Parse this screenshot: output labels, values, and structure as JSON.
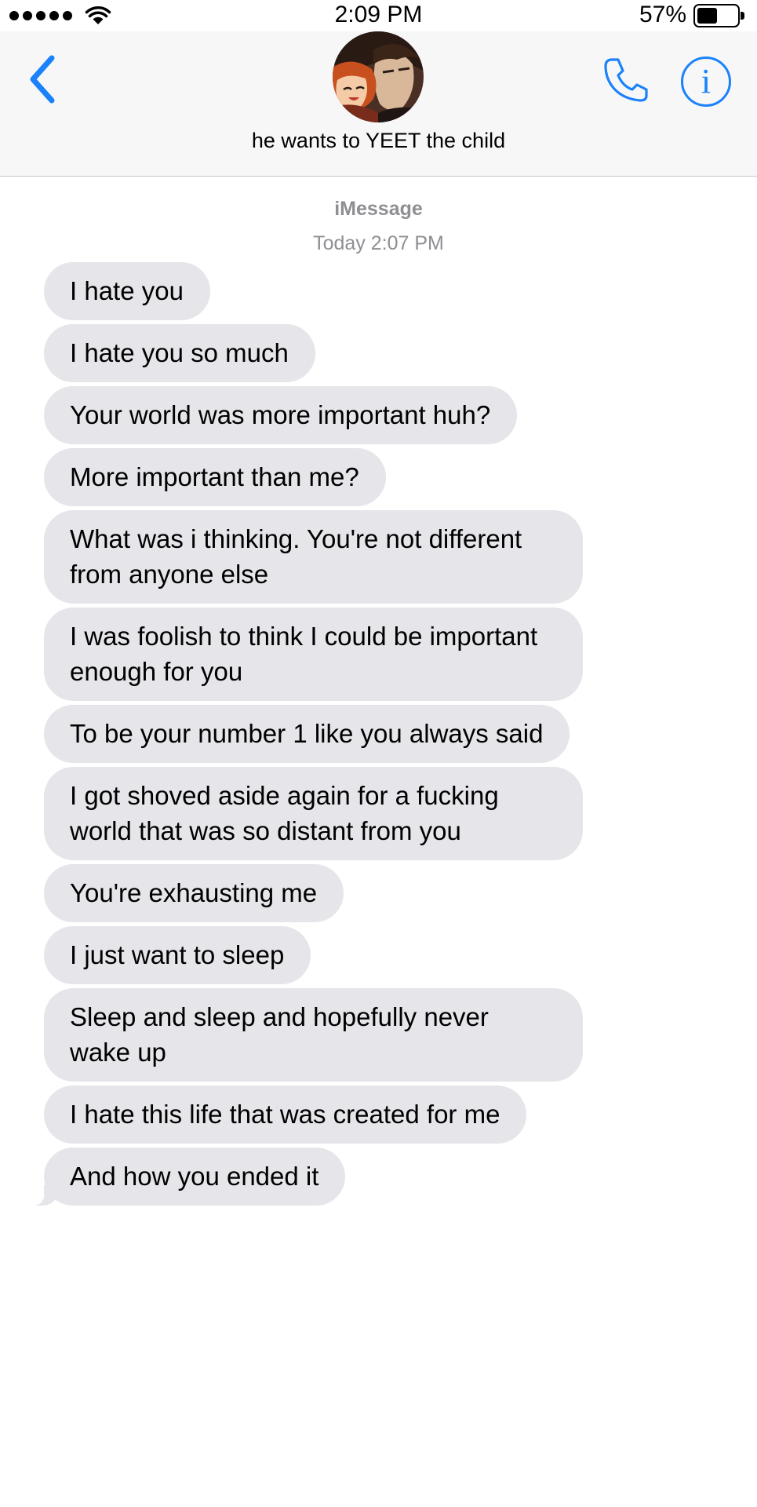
{
  "status_bar": {
    "time": "2:09 PM",
    "battery_percent": "57%",
    "battery_level": 0.57
  },
  "header": {
    "contact_name": "he wants to YEET the child",
    "back_icon": "chevron-left-icon",
    "call_icon": "phone-icon",
    "info_icon": "info-icon",
    "info_label": "i",
    "accent_color": "#1a82fb"
  },
  "conversation": {
    "service": "iMessage",
    "timestamp": "Today 2:07 PM",
    "bubble_color": "#e5e5ea",
    "messages": [
      "I hate you",
      "I hate you so much",
      "Your world was more important huh?",
      "More important than me?",
      "What was i thinking. You're not different from anyone else",
      "I was foolish to think I could be important enough for you",
      "To be your number 1 like you always said",
      "I got shoved aside again for a fucking world that was so distant from you",
      "You're exhausting me",
      "I just want to sleep",
      "Sleep and sleep and hopefully never wake up",
      "I hate this life that was created for me",
      "And how you ended it"
    ]
  }
}
